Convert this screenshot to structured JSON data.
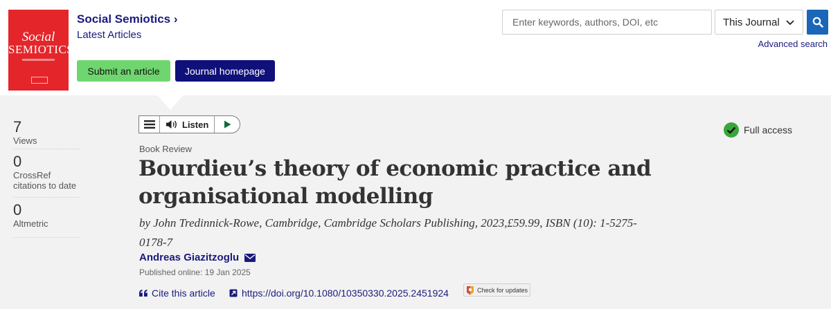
{
  "journal": {
    "name": "Social Semiotics",
    "chevron": "›",
    "latest": "Latest Articles",
    "cover_line1": "Social",
    "cover_line2": "SEMIOTICS",
    "submit_label": "Submit an article",
    "homepage_label": "Journal homepage"
  },
  "search": {
    "placeholder": "Enter keywords, authors, DOI, etc",
    "scope": "This Journal",
    "advanced": "Advanced search"
  },
  "metrics": [
    {
      "value": "7",
      "label": "Views"
    },
    {
      "value": "0",
      "label": "CrossRef citations to date"
    },
    {
      "value": "0",
      "label": "Altmetric"
    }
  ],
  "listen": {
    "label": "Listen"
  },
  "access": {
    "label": "Full access",
    "color": "#3aa63a"
  },
  "article": {
    "type": "Book Review",
    "title": "Bourdieu’s theory of economic practice and organisational modelling",
    "byline": "by John Tredinnick-Rowe, Cambridge, Cambridge Scholars Publishing, 2023,£59.99, ISBN (10): 1-5275-0178-7",
    "author": "Andreas Giazitzoglu",
    "published": "Published online: 19 Jan 2025",
    "cite_label": "Cite this article",
    "doi": "https://doi.org/10.1080/10350330.2025.2451924",
    "updates_label": "Check for updates"
  },
  "colors": {
    "navy": "#1a1a7e",
    "submit_green": "#6fd66f",
    "cover_red": "#e4262b",
    "search_blue": "#1a66b8"
  }
}
